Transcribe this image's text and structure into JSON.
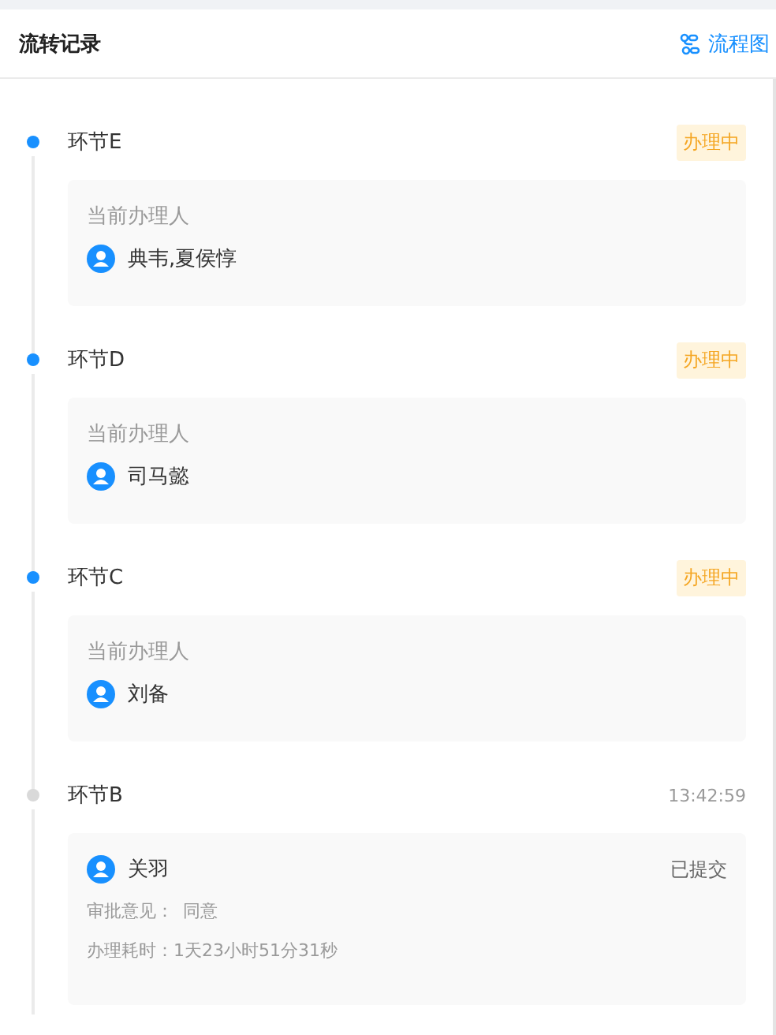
{
  "header": {
    "title": "流转记录",
    "link": "流程图"
  },
  "nodes": [
    {
      "kind": "active",
      "title": "环节E",
      "badge": "办理中",
      "label": "当前办理人",
      "handler": "典韦,夏侯惇"
    },
    {
      "kind": "active",
      "title": "环节D",
      "badge": "办理中",
      "label": "当前办理人",
      "handler": "司马懿"
    },
    {
      "kind": "active",
      "title": "环节C",
      "badge": "办理中",
      "label": "当前办理人",
      "handler": "刘备"
    },
    {
      "kind": "done",
      "title": "环节B",
      "time": "13:42:59",
      "handler": "关羽",
      "status": "已提交",
      "opinion_label": "审批意见：",
      "opinion": "同意",
      "duration_label": "办理耗时：",
      "duration": "1天23小时51分31秒"
    }
  ]
}
